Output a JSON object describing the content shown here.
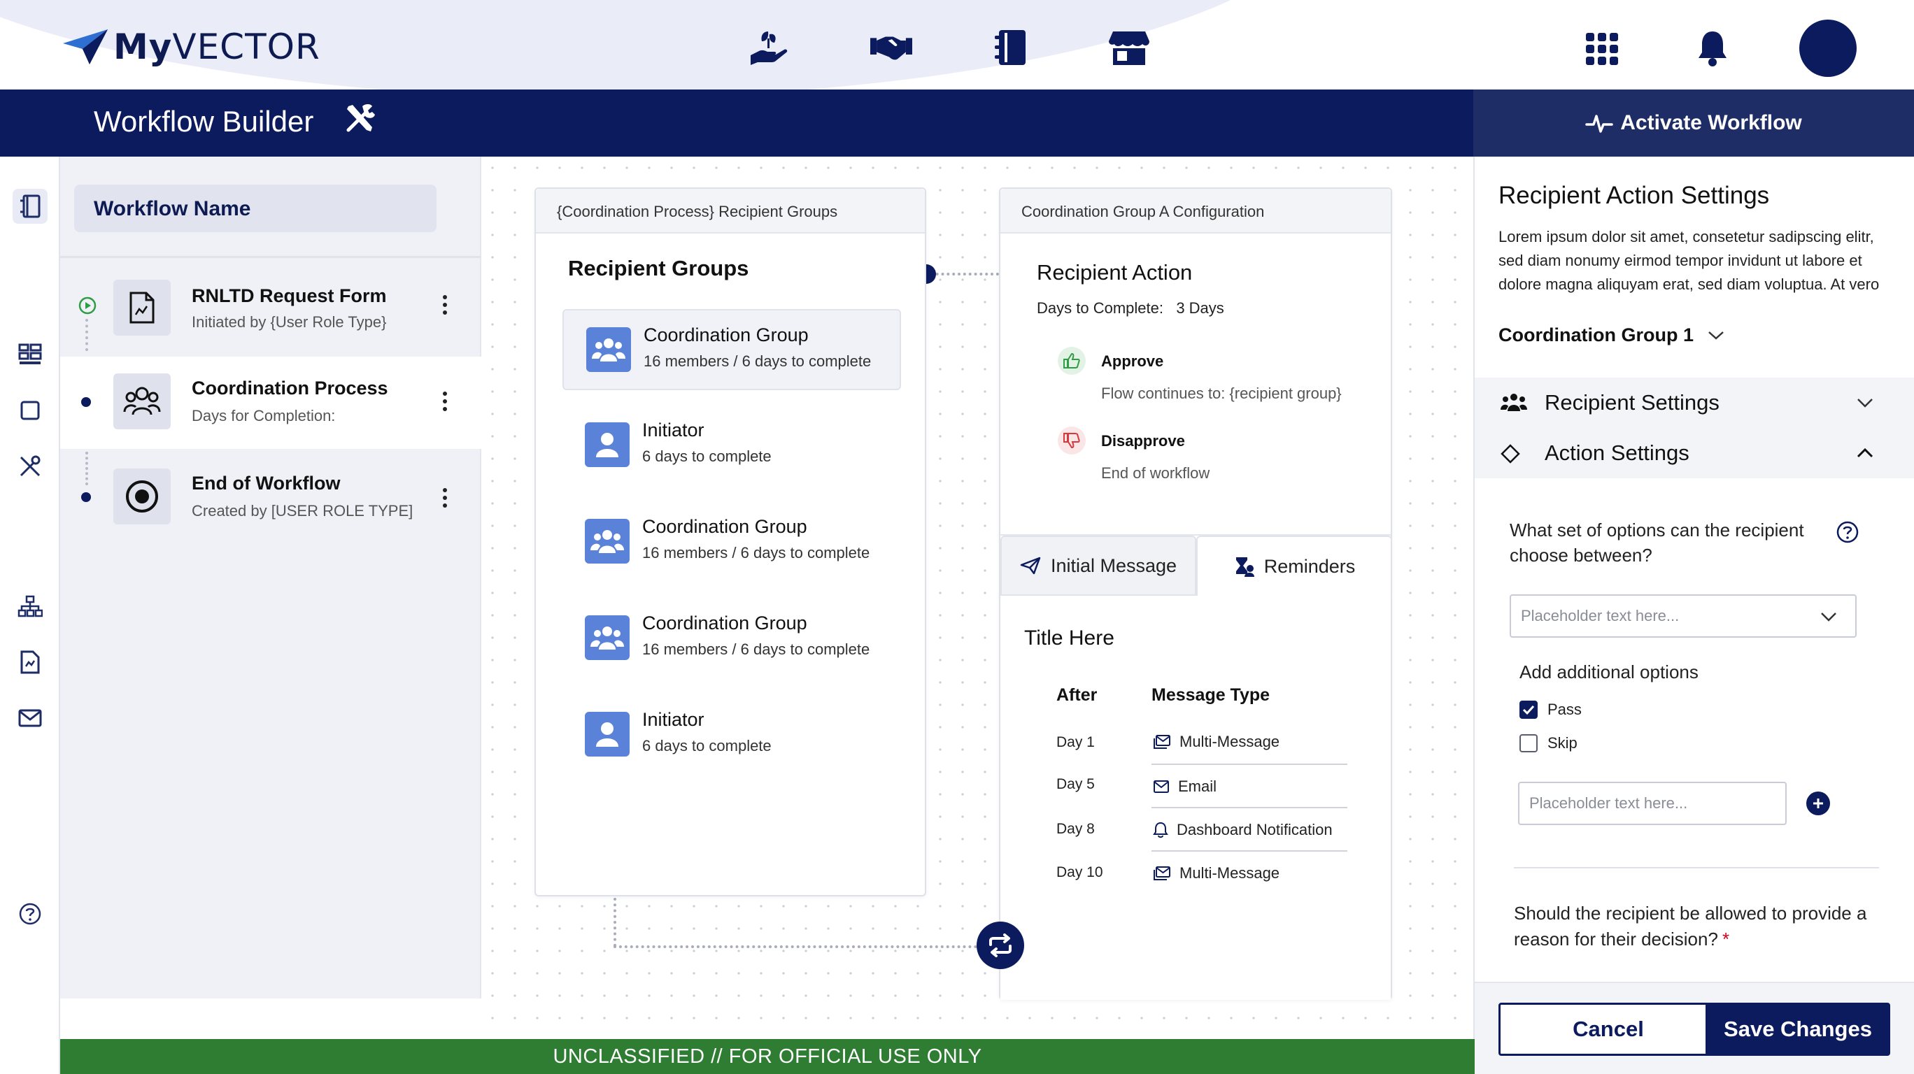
{
  "header": {
    "logo_text_bold": "My",
    "logo_text": "VECTOR",
    "nav_icons": [
      "hand-plant-icon",
      "handshake-icon",
      "book-icon",
      "store-icon"
    ],
    "right_icons": [
      "apps-grid-icon",
      "bell-icon",
      "avatar"
    ]
  },
  "titlebar": {
    "title": "Workflow Builder",
    "activate_label": "Activate Workflow"
  },
  "rail": {
    "icons": [
      "book-icon",
      "dashboard-icon",
      "frame-icon",
      "tools-icon",
      "org-chart-icon",
      "document-icon",
      "mail-icon",
      "help-icon"
    ]
  },
  "workflow": {
    "name_placeholder": "Workflow Name",
    "steps": [
      {
        "title": "RNLTD Request Form",
        "subtitle": "Initiated by {User Role Type}"
      },
      {
        "title": "Coordination Process",
        "subtitle": "Days for Completion:"
      },
      {
        "title": "End of Workflow",
        "subtitle": "Created by [USER ROLE TYPE]"
      }
    ]
  },
  "recipient_groups_card": {
    "header": "{Coordination Process} Recipient Groups",
    "title": "Recipient Groups",
    "items": [
      {
        "name": "Coordination Group",
        "sub": "16 members / 6 days to complete",
        "kind": "group"
      },
      {
        "name": "Initiator",
        "sub": "6 days to complete",
        "kind": "person"
      },
      {
        "name": "Coordination Group",
        "sub": "16 members / 6 days to complete",
        "kind": "group"
      },
      {
        "name": "Coordination Group",
        "sub": "16 members / 6 days to complete",
        "kind": "group"
      },
      {
        "name": "Initiator",
        "sub": "6 days to complete",
        "kind": "person"
      }
    ]
  },
  "config_card": {
    "header": "Coordination Group A Configuration",
    "title": "Recipient Action",
    "days_label": "Days to Complete:",
    "days_value": "3 Days",
    "approve": {
      "title": "Approve",
      "sub": "Flow continues to: {recipient group}"
    },
    "disapprove": {
      "title": "Disapprove",
      "sub": "End of workflow"
    },
    "tabs": [
      "Initial Message",
      "Reminders"
    ],
    "section_title": "Title Here",
    "columns": [
      "After",
      "Message Type"
    ],
    "rows": [
      {
        "day": "Day 1",
        "type": "Multi-Message",
        "icon": "multi-mail-icon"
      },
      {
        "day": "Day 5",
        "type": "Email",
        "icon": "mail-icon"
      },
      {
        "day": "Day 8",
        "type": "Dashboard Notification",
        "icon": "bell-icon"
      },
      {
        "day": "Day 10",
        "type": "Multi-Message",
        "icon": "multi-mail-icon"
      }
    ]
  },
  "right_panel": {
    "title": "Recipient Action Settings",
    "description": "Lorem ipsum dolor sit amet, consetetur sadipscing elitr, sed diam nonumy eirmod tempor invidunt ut labore et dolore magna aliquyam erat, sed diam voluptua. At vero",
    "group_select": "Coordination Group 1",
    "accordion_recipient": "Recipient Settings",
    "accordion_action": "Action Settings",
    "question_1": "What set of options can the recipient choose between?",
    "dropdown_placeholder": "Placeholder text here...",
    "add_options_label": "Add additional options",
    "options": [
      {
        "label": "Pass",
        "checked": true
      },
      {
        "label": "Skip",
        "checked": false
      }
    ],
    "option_input_placeholder": "Placeholder text here...",
    "question_2": "Should the recipient be allowed to provide a reason for their decision?",
    "required_mark": "*",
    "cancel_label": "Cancel",
    "save_label": "Save Changes"
  },
  "banner": {
    "text": "UNCLASSIFIED // FOR OFFICIAL USE ONLY"
  },
  "colors": {
    "navy": "#0c1a5e",
    "banner_green": "#2e7d32",
    "group_icon_blue": "#5b82d9",
    "approve_green": "#2e9e44",
    "disapprove_red": "#d9363e"
  }
}
